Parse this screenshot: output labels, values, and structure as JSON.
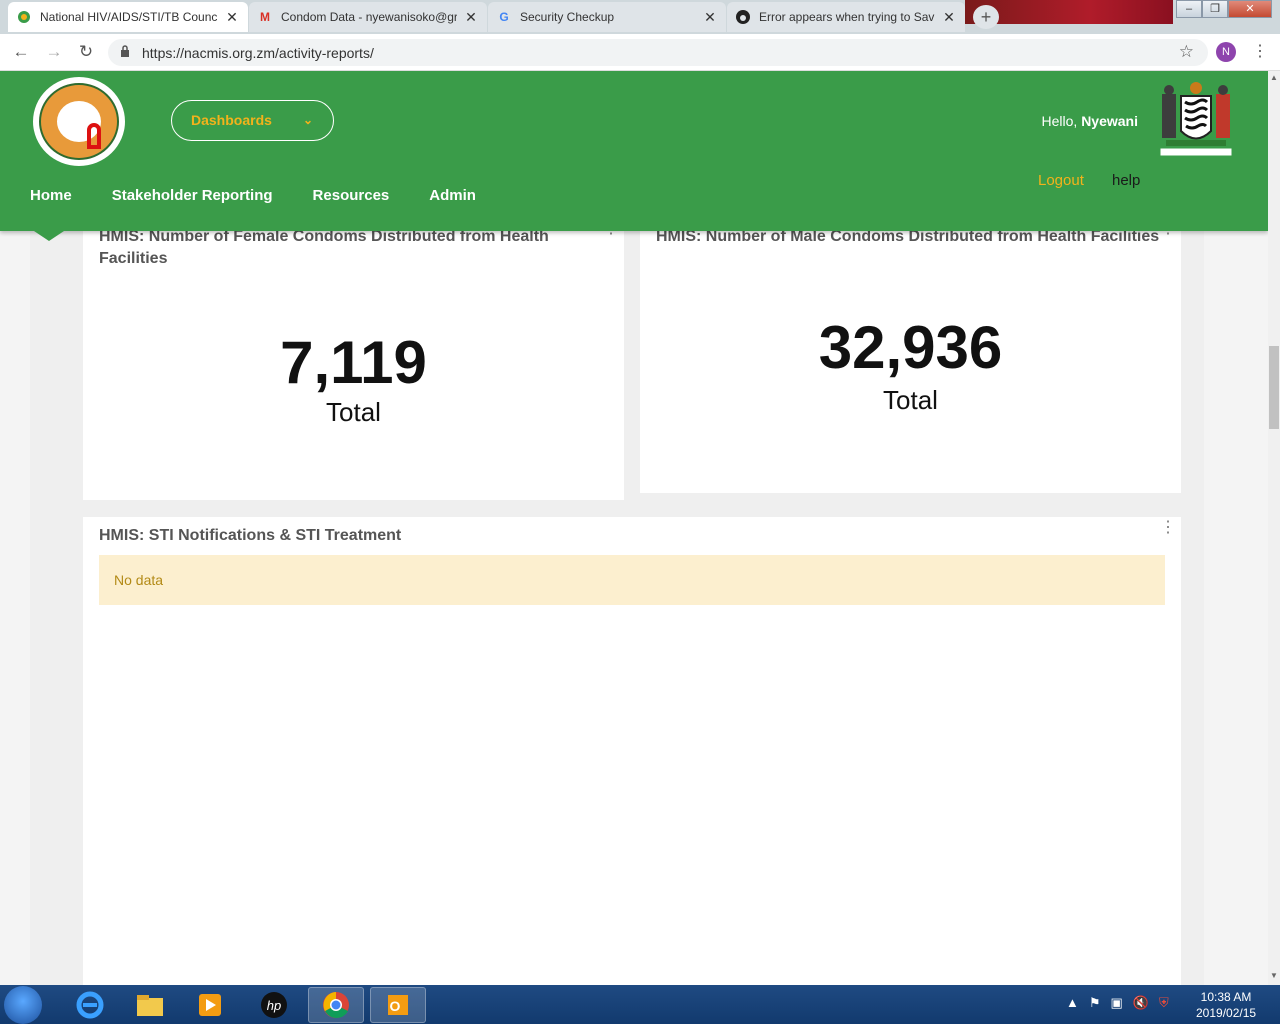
{
  "browser": {
    "tabs": [
      {
        "title": "National HIV/AIDS/STI/TB Counc",
        "icon": "nac-favicon-icon",
        "active": true
      },
      {
        "title": "Condom Data - nyewanisoko@gr",
        "icon": "gmail-icon",
        "active": false
      },
      {
        "title": "Security Checkup",
        "icon": "google-icon",
        "active": false
      },
      {
        "title": "Error appears when trying to Sav",
        "icon": "github-icon",
        "active": false
      }
    ],
    "url": "https://nacmis.org.zm/activity-reports/",
    "profile_initial": "N"
  },
  "header": {
    "dashboards_label": "Dashboards",
    "hello_prefix": "Hello, ",
    "user_name": "Nyewani",
    "logout_label": "Logout",
    "help_label": "help",
    "nav": [
      "Home",
      "Stakeholder Reporting",
      "Resources",
      "Admin"
    ]
  },
  "cards": {
    "female": {
      "title": "HMIS: Number of Female Condoms Distributed from Health Facilities",
      "value": "7,119",
      "label": "Total"
    },
    "male": {
      "title": "HMIS: Number of Male Condoms Distributed from Health Facilities",
      "value": "32,936",
      "label": "Total"
    },
    "sti": {
      "title": "HMIS: STI Notifications & STI Treatment",
      "message": "No data"
    }
  },
  "taskbar": {
    "time": "10:38 AM",
    "date": "2019/02/15"
  },
  "colors": {
    "brand_green": "#3a9c49",
    "accent_orange": "#f3b21b",
    "nodata_bg": "#fcefcf"
  }
}
